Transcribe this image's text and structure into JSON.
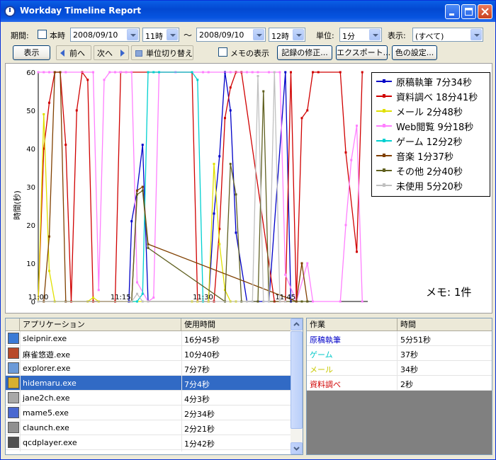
{
  "window": {
    "title": "Workday Timeline Report"
  },
  "toolbar": {
    "period_label": "期間:",
    "today_label": "本時",
    "start_date": "2008/09/10",
    "start_hour": "11時",
    "tilde": "〜",
    "end_date": "2008/09/10",
    "end_hour": "12時",
    "unit_label": "単位:",
    "unit_value": "1分",
    "display_label": "表示:",
    "display_value": "(すべて)",
    "show_button": "表示",
    "prev_button": "前へ",
    "next_button": "次へ",
    "unit_toggle_button": "単位切り替え",
    "memo_show_label": "メモの表示",
    "edit_records_button": "記録の修正...",
    "export_button": "エクスポート...",
    "color_settings_button": "色の設定..."
  },
  "chart_data": {
    "type": "line",
    "title": "",
    "xlabel": "",
    "ylabel": "時間(秒)",
    "ylim": [
      0,
      60
    ],
    "yticks": [
      "0",
      "10",
      "20",
      "30",
      "40",
      "50",
      "60"
    ],
    "xticks": [
      "11:00",
      "11:15",
      "11:30",
      "11:45"
    ],
    "xlim": [
      0,
      60
    ],
    "grid": false,
    "legend_position": "top-right",
    "series": [
      {
        "name": "原稿執筆 7分34秒",
        "color": "#0000c8",
        "x": [
          16.5,
          17,
          18,
          19,
          20,
          31,
          32,
          33,
          34,
          35,
          36,
          38,
          42,
          45,
          46
        ],
        "y": [
          0,
          21,
          29,
          41,
          0,
          0,
          23,
          38,
          60,
          50,
          18,
          0,
          0,
          60,
          0
        ]
      },
      {
        "name": "資料調べ 18分41秒",
        "color": "#d00000",
        "x": [
          0,
          1,
          2,
          3,
          4,
          5,
          6,
          7,
          8,
          9,
          10,
          14,
          15,
          22,
          28,
          29,
          30,
          31,
          32,
          33,
          34,
          35,
          36,
          37,
          43,
          44,
          45,
          46,
          47,
          48,
          49,
          50,
          51,
          55,
          56,
          58,
          59
        ],
        "y": [
          0,
          40,
          52,
          60,
          60,
          41,
          0,
          50,
          60,
          58,
          0,
          0,
          60,
          60,
          60,
          0,
          0,
          0,
          0,
          19,
          48,
          56,
          60,
          60,
          0,
          0,
          0,
          60,
          0,
          48,
          50,
          60,
          60,
          60,
          39,
          13,
          60
        ]
      },
      {
        "name": "メール 2分48秒",
        "color": "#e0e000",
        "x": [
          0,
          1,
          2,
          3,
          9,
          10,
          11,
          28,
          29,
          30,
          31,
          32,
          33,
          34,
          35,
          36
        ],
        "y": [
          0,
          49,
          8,
          0,
          0,
          1,
          0,
          0,
          0,
          0,
          0,
          36,
          15,
          3,
          0,
          0
        ]
      },
      {
        "name": "Web閲覧 9分18秒",
        "color": "#ff7fff",
        "x": [
          0,
          1,
          2,
          3,
          4,
          5,
          10,
          11,
          12,
          13,
          14,
          15,
          16,
          17,
          18,
          20,
          21,
          22,
          25,
          28,
          30,
          31,
          35,
          38,
          39,
          40,
          42,
          44,
          45,
          47,
          49,
          50,
          55,
          56,
          57,
          58,
          59
        ],
        "y": [
          60,
          60,
          60,
          60,
          60,
          60,
          60,
          3,
          58,
          60,
          60,
          60,
          60,
          60,
          5,
          0,
          1,
          60,
          60,
          60,
          60,
          60,
          60,
          60,
          60,
          60,
          60,
          60,
          7,
          0,
          10,
          0,
          0,
          20,
          37,
          46,
          0
        ]
      },
      {
        "name": "ゲーム 12分2秒",
        "color": "#00d0d0",
        "x": [
          17,
          18,
          19,
          20,
          21,
          22,
          28,
          29,
          30
        ],
        "y": [
          0,
          0,
          2,
          60,
          60,
          60,
          60,
          58,
          0
        ]
      },
      {
        "name": "音楽 1分37秒",
        "color": "#804000",
        "x": [
          1,
          2,
          3,
          4,
          5,
          17,
          18,
          19,
          20,
          47,
          48,
          49
        ],
        "y": [
          0,
          17,
          60,
          60,
          0,
          0,
          29,
          30,
          15,
          0,
          10,
          0
        ]
      },
      {
        "name": "その他 2分40秒",
        "color": "#606020",
        "x": [
          0,
          17,
          18,
          19,
          20,
          34,
          35,
          36,
          37,
          40,
          41,
          42,
          48,
          49
        ],
        "y": [
          0,
          0,
          28,
          29,
          14,
          0,
          36,
          28,
          0,
          0,
          55,
          0,
          0,
          0
        ]
      },
      {
        "name": "未使用 5分20秒",
        "color": "#c0c0c0",
        "x": [
          0,
          17,
          18,
          19,
          20,
          38,
          39,
          40,
          41,
          42,
          43,
          44,
          45
        ],
        "y": [
          0,
          0,
          2,
          0,
          0,
          0,
          0,
          59,
          0,
          0,
          60,
          0,
          0
        ]
      }
    ]
  },
  "memo": {
    "label": "メモ: 1件"
  },
  "app_list": {
    "headers": [
      "アプリケーション",
      "使用時間"
    ],
    "rows": [
      {
        "name": "sleipnir.exe",
        "time": "16分45秒",
        "icon": "sleipnir-icon",
        "color": "#3a7ad6"
      },
      {
        "name": "麻雀悠遊.exe",
        "time": "10分40秒",
        "icon": "mahjong-icon",
        "color": "#b84a2a"
      },
      {
        "name": "explorer.exe",
        "time": "7分7秒",
        "icon": "explorer-icon",
        "color": "#6c9ad8"
      },
      {
        "name": "hidemaru.exe",
        "time": "7分4秒",
        "icon": "hidemaru-icon",
        "color": "#d8b030"
      },
      {
        "name": "jane2ch.exe",
        "time": "4分3秒",
        "icon": "jane-icon",
        "color": "#a8a8a8"
      },
      {
        "name": "mame5.exe",
        "time": "2分34秒",
        "icon": "mame-icon",
        "color": "#4a68d0"
      },
      {
        "name": "claunch.exe",
        "time": "2分21秒",
        "icon": "claunch-icon",
        "color": "#909090"
      },
      {
        "name": "qcdplayer.exe",
        "time": "1分42秒",
        "icon": "qcd-icon",
        "color": "#505050"
      }
    ],
    "selected_index": 3
  },
  "task_list": {
    "headers": [
      "作業",
      "時間"
    ],
    "rows": [
      {
        "name": "原稿執筆",
        "time": "5分51秒",
        "color": "#0000c8"
      },
      {
        "name": "ゲーム",
        "time": "37秒",
        "color": "#00c8c8"
      },
      {
        "name": "メール",
        "time": "34秒",
        "color": "#c8c800"
      },
      {
        "name": "資料調べ",
        "time": "2秒",
        "color": "#d00000"
      }
    ]
  }
}
